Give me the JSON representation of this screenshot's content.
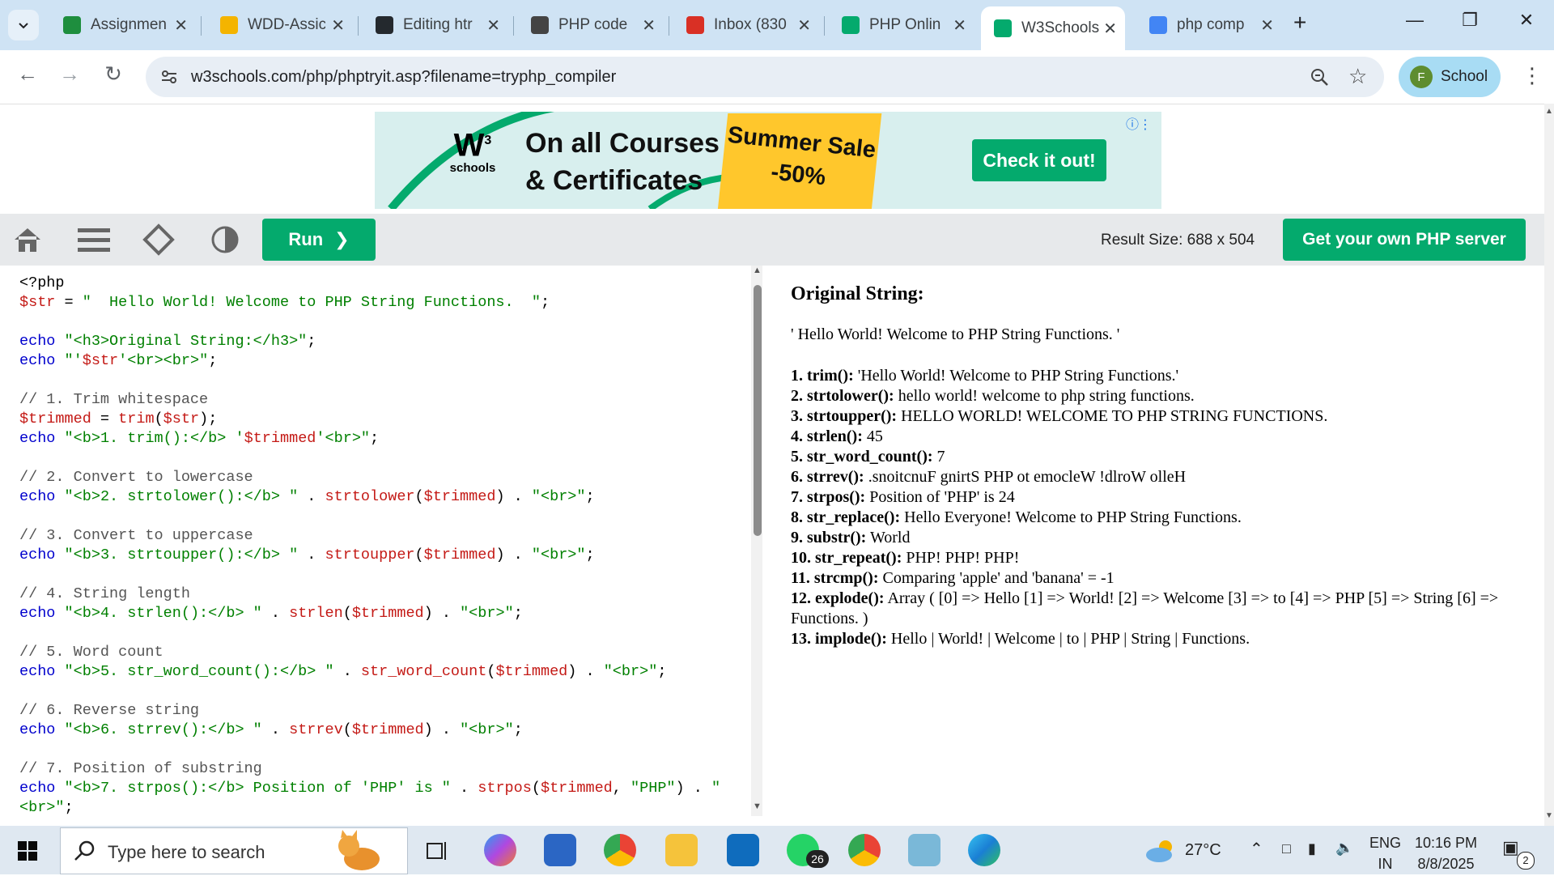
{
  "browser": {
    "tabs": [
      {
        "label": "Assignmen",
        "icon": "google-classroom-icon",
        "color": "#1e8e3e"
      },
      {
        "label": "WDD-Assic",
        "icon": "google-drive-icon",
        "color": "#f4b400"
      },
      {
        "label": "Editing htr",
        "icon": "github-icon",
        "color": "#24292e"
      },
      {
        "label": "PHP code",
        "icon": "chatgpt-icon",
        "color": "#444444"
      },
      {
        "label": "Inbox (830",
        "icon": "gmail-icon",
        "color": "#d93025"
      },
      {
        "label": "PHP Onlin",
        "icon": "w3schools-icon",
        "color": "#04aa6d"
      },
      {
        "label": "W3Schools",
        "icon": "w3schools-icon",
        "color": "#04aa6d"
      },
      {
        "label": "php comp",
        "icon": "google-icon",
        "color": "#4285f4"
      }
    ],
    "url": "w3schools.com/php/phptryit.asp?filename=tryphp_compiler",
    "profile_initial": "F",
    "profile_name": "School"
  },
  "ad": {
    "logo_text": "schools",
    "logo_sup": "3",
    "headline_1": "On all Courses",
    "headline_2": "& Certificates",
    "sale_1": "Summer Sale",
    "sale_2": "-50%",
    "cta": "Check it out!"
  },
  "toolbar": {
    "run_label": "Run",
    "result_size": "Result Size: 688 x 504",
    "own_server": "Get your own PHP server"
  },
  "code_lines": [
    [
      [
        "<?php",
        "p"
      ]
    ],
    [
      [
        "$str",
        "v"
      ],
      [
        " = ",
        "p"
      ],
      [
        "\"  Hello World! Welcome to PHP String Functions.  \"",
        "s"
      ],
      [
        ";",
        "p"
      ]
    ],
    [],
    [
      [
        "echo",
        "k"
      ],
      [
        " ",
        "p"
      ],
      [
        "\"<h3>Original String:</h3>\"",
        "s"
      ],
      [
        ";",
        "p"
      ]
    ],
    [
      [
        "echo",
        "k"
      ],
      [
        " ",
        "p"
      ],
      [
        "\"'",
        "s"
      ],
      [
        "$str",
        "v"
      ],
      [
        "'<br><br>\"",
        "s"
      ],
      [
        ";",
        "p"
      ]
    ],
    [],
    [
      [
        "// 1. Trim whitespace",
        "c"
      ]
    ],
    [
      [
        "$trimmed",
        "v"
      ],
      [
        " = ",
        "p"
      ],
      [
        "trim",
        "f"
      ],
      [
        "(",
        "p"
      ],
      [
        "$str",
        "v"
      ],
      [
        ");",
        "p"
      ]
    ],
    [
      [
        "echo",
        "k"
      ],
      [
        " ",
        "p"
      ],
      [
        "\"<b>1. trim():</b> '",
        "s"
      ],
      [
        "$trimmed",
        "v"
      ],
      [
        "'<br>\"",
        "s"
      ],
      [
        ";",
        "p"
      ]
    ],
    [],
    [
      [
        "// 2. Convert to lowercase",
        "c"
      ]
    ],
    [
      [
        "echo",
        "k"
      ],
      [
        " ",
        "p"
      ],
      [
        "\"<b>2. strtolower():</b> \"",
        "s"
      ],
      [
        " . ",
        "p"
      ],
      [
        "strtolower",
        "f"
      ],
      [
        "(",
        "p"
      ],
      [
        "$trimmed",
        "v"
      ],
      [
        ") . ",
        "p"
      ],
      [
        "\"<br>\"",
        "s"
      ],
      [
        ";",
        "p"
      ]
    ],
    [],
    [
      [
        "// 3. Convert to uppercase",
        "c"
      ]
    ],
    [
      [
        "echo",
        "k"
      ],
      [
        " ",
        "p"
      ],
      [
        "\"<b>3. strtoupper():</b> \"",
        "s"
      ],
      [
        " . ",
        "p"
      ],
      [
        "strtoupper",
        "f"
      ],
      [
        "(",
        "p"
      ],
      [
        "$trimmed",
        "v"
      ],
      [
        ") . ",
        "p"
      ],
      [
        "\"<br>\"",
        "s"
      ],
      [
        ";",
        "p"
      ]
    ],
    [],
    [
      [
        "// 4. String length",
        "c"
      ]
    ],
    [
      [
        "echo",
        "k"
      ],
      [
        " ",
        "p"
      ],
      [
        "\"<b>4. strlen():</b> \"",
        "s"
      ],
      [
        " . ",
        "p"
      ],
      [
        "strlen",
        "f"
      ],
      [
        "(",
        "p"
      ],
      [
        "$trimmed",
        "v"
      ],
      [
        ") . ",
        "p"
      ],
      [
        "\"<br>\"",
        "s"
      ],
      [
        ";",
        "p"
      ]
    ],
    [],
    [
      [
        "// 5. Word count",
        "c"
      ]
    ],
    [
      [
        "echo",
        "k"
      ],
      [
        " ",
        "p"
      ],
      [
        "\"<b>5. str_word_count():</b> \"",
        "s"
      ],
      [
        " . ",
        "p"
      ],
      [
        "str_word_count",
        "f"
      ],
      [
        "(",
        "p"
      ],
      [
        "$trimmed",
        "v"
      ],
      [
        ") . ",
        "p"
      ],
      [
        "\"<br>\"",
        "s"
      ],
      [
        ";",
        "p"
      ]
    ],
    [],
    [
      [
        "// 6. Reverse string",
        "c"
      ]
    ],
    [
      [
        "echo",
        "k"
      ],
      [
        " ",
        "p"
      ],
      [
        "\"<b>6. strrev():</b> \"",
        "s"
      ],
      [
        " . ",
        "p"
      ],
      [
        "strrev",
        "f"
      ],
      [
        "(",
        "p"
      ],
      [
        "$trimmed",
        "v"
      ],
      [
        ") . ",
        "p"
      ],
      [
        "\"<br>\"",
        "s"
      ],
      [
        ";",
        "p"
      ]
    ],
    [],
    [
      [
        "// 7. Position of substring",
        "c"
      ]
    ],
    [
      [
        "echo",
        "k"
      ],
      [
        " ",
        "p"
      ],
      [
        "\"<b>7. strpos():</b> Position of 'PHP' is \"",
        "s"
      ],
      [
        " . ",
        "p"
      ],
      [
        "strpos",
        "f"
      ],
      [
        "(",
        "p"
      ],
      [
        "$trimmed",
        "v"
      ],
      [
        ", ",
        "p"
      ],
      [
        "\"PHP\"",
        "s"
      ],
      [
        ") . ",
        "p"
      ],
      [
        "\"",
        "s"
      ]
    ],
    [
      [
        "<br>\"",
        "s"
      ],
      [
        ";",
        "p"
      ]
    ]
  ],
  "result": {
    "heading": "Original String:",
    "original": "' Hello World! Welcome to PHP String Functions. '",
    "items": [
      {
        "label": "1. trim():",
        "text": " 'Hello World! Welcome to PHP String Functions.'"
      },
      {
        "label": "2. strtolower():",
        "text": " hello world! welcome to php string functions."
      },
      {
        "label": "3. strtoupper():",
        "text": " HELLO WORLD! WELCOME TO PHP STRING FUNCTIONS."
      },
      {
        "label": "4. strlen():",
        "text": " 45"
      },
      {
        "label": "5. str_word_count():",
        "text": " 7"
      },
      {
        "label": "6. strrev():",
        "text": " .snoitcnuF gnirtS PHP ot emocleW !dlroW olleH"
      },
      {
        "label": "7. strpos():",
        "text": " Position of 'PHP' is 24"
      },
      {
        "label": "8. str_replace():",
        "text": " Hello Everyone! Welcome to PHP String Functions."
      },
      {
        "label": "9. substr():",
        "text": " World"
      },
      {
        "label": "10. str_repeat():",
        "text": " PHP! PHP! PHP!"
      },
      {
        "label": "11. strcmp():",
        "text": " Comparing 'apple' and 'banana' = -1"
      },
      {
        "label": "12. explode():",
        "text": " Array ( [0] => Hello [1] => World! [2] => Welcome [3] => to [4] => PHP [5] => String [6] => Functions. )"
      },
      {
        "label": "13. implode():",
        "text": " Hello | World! | Welcome | to | PHP | String | Functions."
      }
    ]
  },
  "taskbar": {
    "search_placeholder": "Type here to search",
    "whatsapp_badge": "26",
    "weather": "27°C",
    "lang_1": "ENG",
    "lang_2": "IN",
    "time": "10:16 PM",
    "date": "8/8/2025",
    "notif_badge": "2"
  }
}
